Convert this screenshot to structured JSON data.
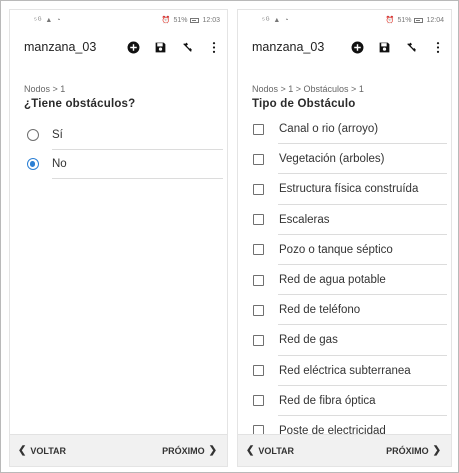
{
  "left": {
    "status": {
      "signal": "⁵ᴳ ▲ ◔",
      "alarm": "⏰",
      "battery": "51%",
      "time": "12:03"
    },
    "app_title": "manzana_03",
    "breadcrumb": "Nodos > 1",
    "question": "¿Tiene obstáculos?",
    "options": [
      {
        "label": "Sí",
        "selected": false
      },
      {
        "label": "No",
        "selected": true
      }
    ],
    "nav": {
      "back": "VOLTAR",
      "next": "PRÓXIMO"
    }
  },
  "right": {
    "status": {
      "signal": "⁵ᴳ ▲ ◔",
      "alarm": "⏰",
      "battery": "51%",
      "time": "12:04"
    },
    "app_title": "manzana_03",
    "breadcrumb": "Nodos > 1 > Obstáculos > 1",
    "question": "Tipo de Obstáculo",
    "options": [
      {
        "label": "Canal o rio (arroyo)",
        "checked": false
      },
      {
        "label": "Vegetación (arboles)",
        "checked": false
      },
      {
        "label": "Estructura física construída",
        "checked": false
      },
      {
        "label": "Escaleras",
        "checked": false
      },
      {
        "label": "Pozo o tanque séptico",
        "checked": false
      },
      {
        "label": "Red de agua potable",
        "checked": false
      },
      {
        "label": "Red de teléfono",
        "checked": false
      },
      {
        "label": "Red de gas",
        "checked": false
      },
      {
        "label": "Red eléctrica subterranea",
        "checked": false
      },
      {
        "label": "Red de fibra óptica",
        "checked": false
      },
      {
        "label": "Poste de electricidad",
        "checked": false
      }
    ],
    "nav": {
      "back": "VOLTAR",
      "next": "PRÓXIMO"
    }
  },
  "icons": {
    "add": "add-circle-icon",
    "save": "save-icon",
    "location": "location-off-icon",
    "more": "more-vert-icon"
  },
  "colors": {
    "accent": "#2b7fd4",
    "nav_bg": "#f1f1f1"
  }
}
